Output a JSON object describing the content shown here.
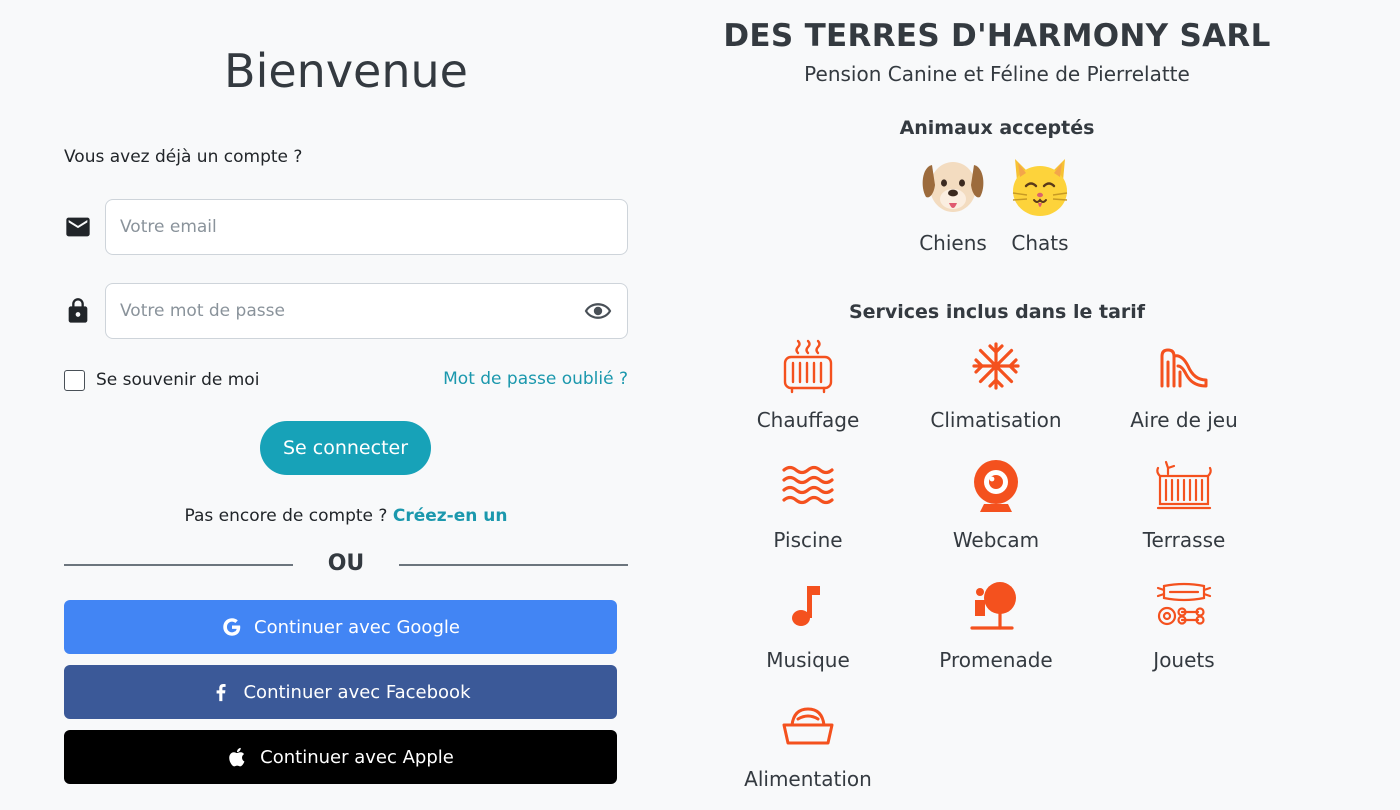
{
  "login": {
    "title": "Bienvenue",
    "subtitle": "Vous avez déjà un compte ?",
    "email_placeholder": "Votre email",
    "password_placeholder": "Votre mot de passe",
    "remember_label": "Se souvenir de moi",
    "forgot_label": "Mot de passe oublié ?",
    "connect_label": "Se connecter",
    "no_account_text": "Pas encore de compte ?",
    "create_link": "Créez-en un",
    "or_label": "OU",
    "google_label": "Continuer avec Google",
    "facebook_label": "Continuer avec Facebook",
    "apple_label": "Continuer avec Apple"
  },
  "info": {
    "company": "DES TERRES D'HARMONY SARL",
    "tagline": "Pension Canine et Féline de Pierrelatte",
    "animals_title": "Animaux acceptés",
    "animals": [
      {
        "label": "Chiens",
        "icon": "dog-face-icon"
      },
      {
        "label": "Chats",
        "icon": "cat-face-icon"
      }
    ],
    "services_title": "Services inclus dans le tarif",
    "services": [
      {
        "label": "Chauffage",
        "icon": "heater-icon"
      },
      {
        "label": "Climatisation",
        "icon": "snowflake-icon"
      },
      {
        "label": "Aire de jeu",
        "icon": "slide-icon"
      },
      {
        "label": "Piscine",
        "icon": "waves-icon"
      },
      {
        "label": "Webcam",
        "icon": "webcam-icon"
      },
      {
        "label": "Terrasse",
        "icon": "terrace-icon"
      },
      {
        "label": "Musique",
        "icon": "music-note-icon"
      },
      {
        "label": "Promenade",
        "icon": "walk-tree-icon"
      },
      {
        "label": "Jouets",
        "icon": "toys-icon"
      },
      {
        "label": "Alimentation",
        "icon": "food-bowl-icon"
      }
    ]
  },
  "colors": {
    "background": "#f8f9fa",
    "accent": "#17a2b8",
    "link": "#1b98ad",
    "service_icon": "#f4511e",
    "google": "#4285f4",
    "facebook": "#3b5998",
    "apple": "#000000"
  }
}
